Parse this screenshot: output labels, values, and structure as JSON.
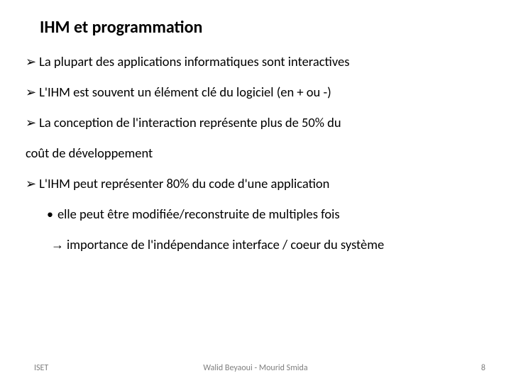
{
  "title": "IHM et programmation",
  "bullets": {
    "b1": "La plupart des applications informatiques sont interactives",
    "b2": "L'IHM est souvent un élément clé du logiciel (en + ou -)",
    "b3": "La conception de l'interaction représente plus de 50% du",
    "b3_cont": "coût de développement",
    "b4": "L'IHM peut représenter 80% du code d'une application",
    "b4_1": "elle peut être modifiée/reconstruite de multiples fois",
    "b4_2": "importance de l'indépendance interface / coeur du système"
  },
  "markers": {
    "triangle": "➢",
    "bullet": "•",
    "arrow": "→"
  },
  "footer": {
    "left": "ISET",
    "center": "Walid Beyaoui - Mourid Smida",
    "page": "8"
  }
}
